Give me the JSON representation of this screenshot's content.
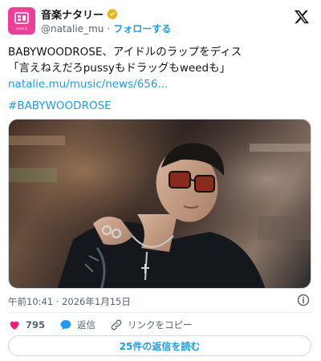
{
  "account": {
    "display_name": "音楽ナタリー",
    "handle": "@natalie_mu",
    "separator": "·",
    "follow_label": "フォローする",
    "avatar_text": "natalie"
  },
  "tweet": {
    "line1": "BABYWOODROSE、アイドルのラップをディス",
    "line2": "「言えねえだろpussyもドラッグもweedも」",
    "link": "natalie.mu/music/news/656...",
    "hashtag": "#BABYWOODROSE"
  },
  "timestamp": "午前10:41 · 2026年1月15日",
  "actions": {
    "likes": "795",
    "reply_label": "返信",
    "copy_link_label": "リンクをコピー"
  },
  "read_replies_label": "25件の返信を読む",
  "colors": {
    "accent": "#1d9bf0",
    "like": "#f91880",
    "avatar": "#ee3f96",
    "verified": "#e8b418"
  }
}
